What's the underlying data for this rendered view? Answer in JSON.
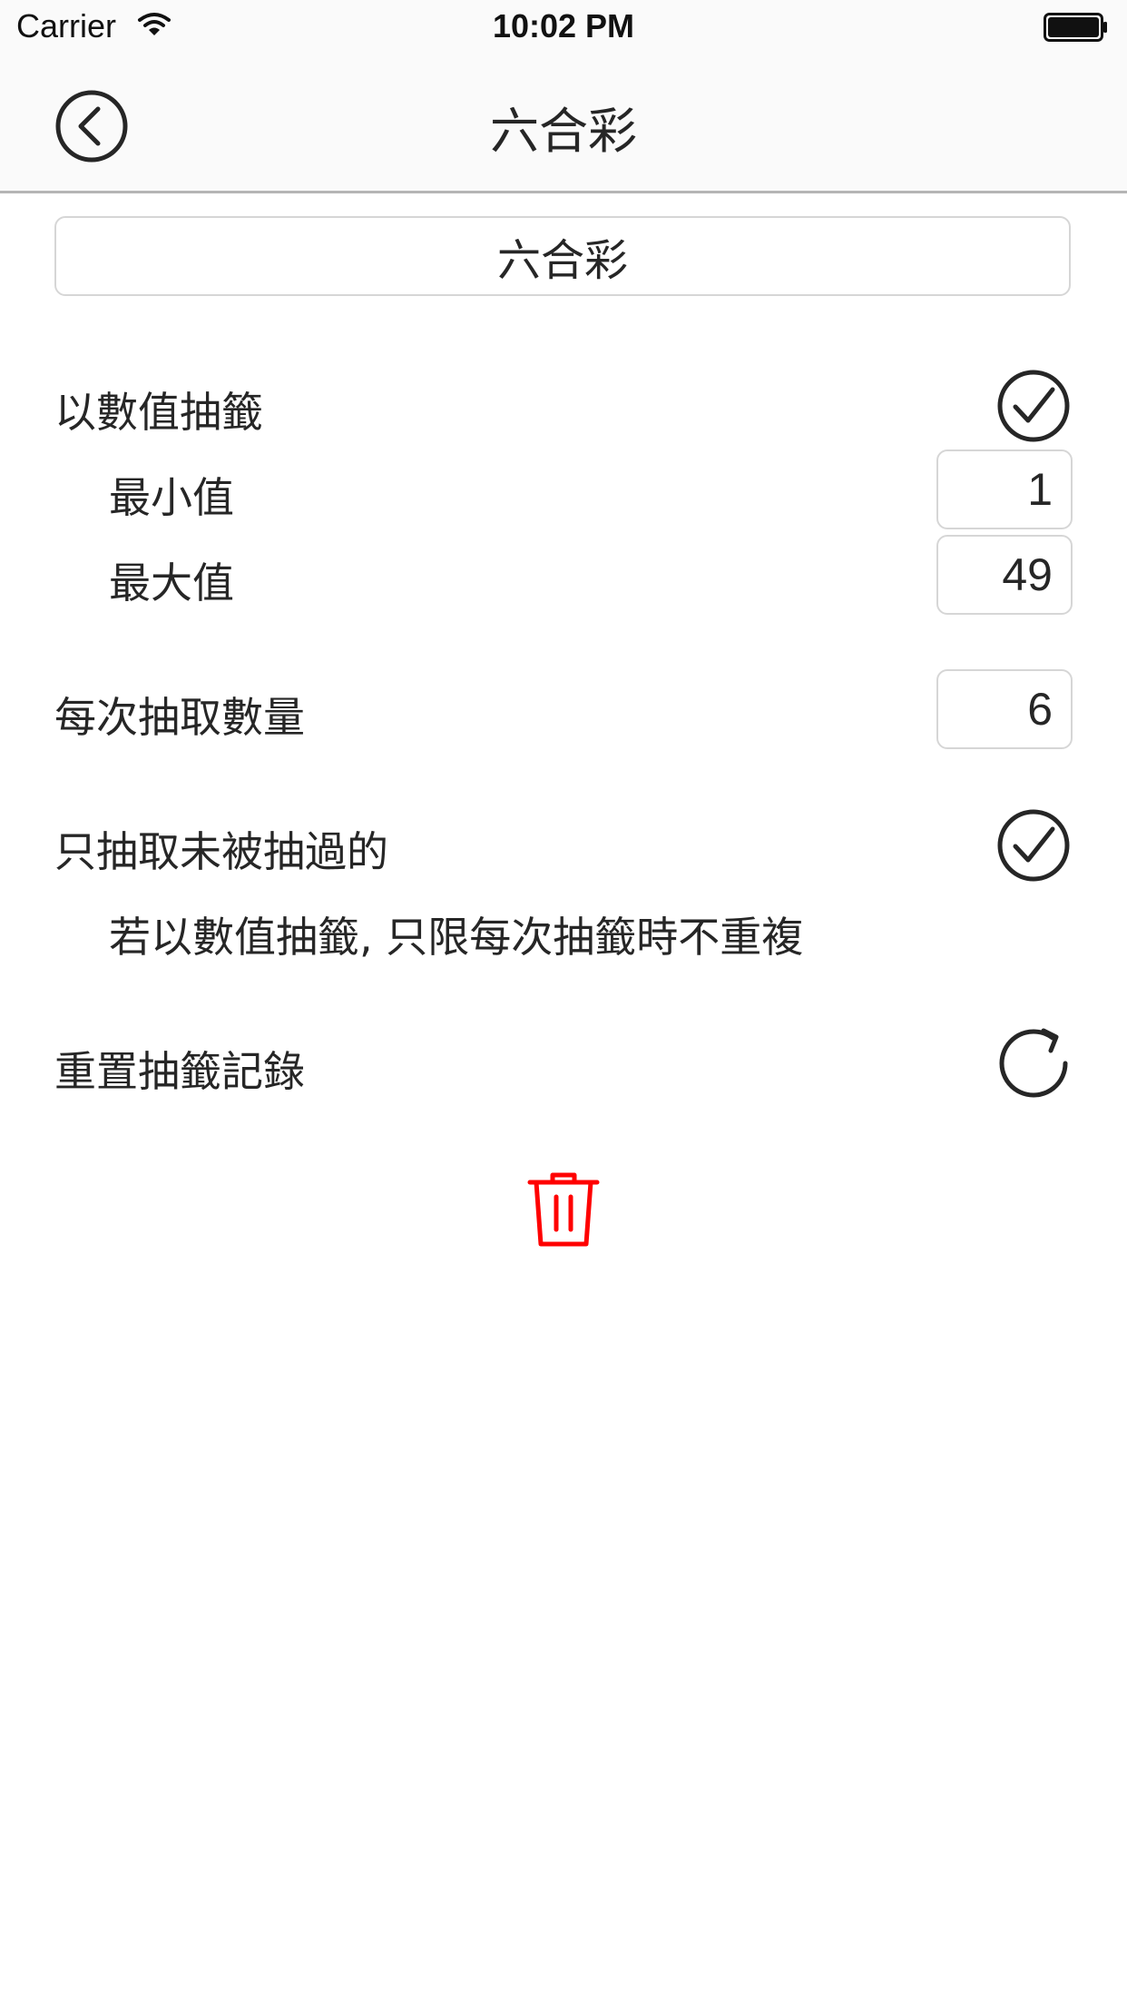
{
  "status_bar": {
    "carrier": "Carrier",
    "time": "10:02 PM"
  },
  "nav": {
    "title": "六合彩",
    "back_icon": "chevron-left-circle-icon"
  },
  "form": {
    "name_value": "六合彩",
    "draw_by_number_label": "以數值抽籤",
    "draw_by_number_checked": true,
    "min_label": "最小值",
    "min_value": "1",
    "max_label": "最大值",
    "max_value": "49",
    "count_label": "每次抽取數量",
    "count_value": "6",
    "undrawn_only_label": "只抽取未被抽過的",
    "undrawn_only_checked": true,
    "undrawn_note": "若以數值抽籤, 只限每次抽籤時不重複",
    "reset_label": "重置抽籤記錄",
    "reset_icon": "refresh-icon",
    "delete_icon": "trash-icon"
  },
  "colors": {
    "text": "#262626",
    "delete": "#ff0000",
    "border": "#d6d6d6",
    "navbar_bg": "#fafafa"
  }
}
